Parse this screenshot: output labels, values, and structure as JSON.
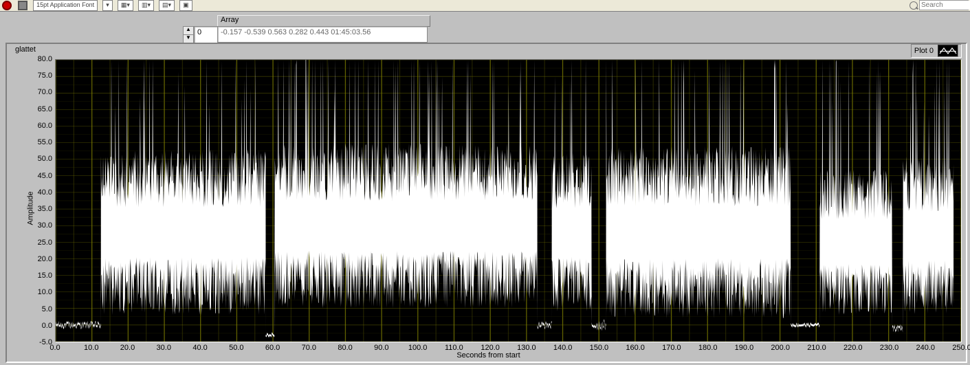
{
  "toolbar": {
    "font_selector": "15pt Application Font",
    "search_placeholder": "Search"
  },
  "array_control": {
    "label": "Array",
    "index": "0",
    "value": "-0.157 -0.539 0.563 0.282 0.443  01:45:03.56"
  },
  "graph": {
    "label": "glattet",
    "legend_label": "Plot 0"
  },
  "chart_data": {
    "type": "line",
    "title": "",
    "xlabel": "Seconds from start",
    "ylabel": "Amplitude",
    "xlim": [
      0,
      250
    ],
    "ylim": [
      -5,
      80
    ],
    "xticks": [
      0,
      10,
      20,
      30,
      40,
      50,
      60,
      70,
      80,
      90,
      100,
      110,
      120,
      130,
      140,
      150,
      160,
      170,
      180,
      190,
      200,
      210,
      220,
      230,
      240,
      250
    ],
    "yticks": [
      -5,
      0,
      5,
      10,
      15,
      20,
      25,
      30,
      35,
      40,
      45,
      50,
      55,
      60,
      65,
      70,
      75,
      80
    ],
    "series_name": "Plot 0",
    "segments": [
      {
        "x0": 0,
        "x1": 12.5,
        "base": 0,
        "jitter": 2,
        "peak": 2,
        "density": "sparse"
      },
      {
        "x0": 12.5,
        "x1": 58,
        "base": 28,
        "jitter": 25,
        "peak": 75,
        "density": "dense"
      },
      {
        "x0": 58,
        "x1": 60.5,
        "base": -3,
        "jitter": 1,
        "peak": 0,
        "density": "sparse"
      },
      {
        "x0": 60.5,
        "x1": 133,
        "base": 30,
        "jitter": 25,
        "peak": 78,
        "density": "dense"
      },
      {
        "x0": 133,
        "x1": 137,
        "base": 0,
        "jitter": 2,
        "peak": 4,
        "density": "sparse"
      },
      {
        "x0": 137,
        "x1": 148,
        "base": 28,
        "jitter": 24,
        "peak": 72,
        "density": "dense"
      },
      {
        "x0": 148,
        "x1": 152,
        "base": 0,
        "jitter": 3,
        "peak": 5,
        "density": "sparse"
      },
      {
        "x0": 152,
        "x1": 203,
        "base": 28,
        "jitter": 26,
        "peak": 76,
        "density": "dense"
      },
      {
        "x0": 203,
        "x1": 211,
        "base": 0,
        "jitter": 1,
        "peak": 1,
        "density": "sparse"
      },
      {
        "x0": 211,
        "x1": 231,
        "base": 25,
        "jitter": 22,
        "peak": 74,
        "density": "dense"
      },
      {
        "x0": 231,
        "x1": 234,
        "base": -1,
        "jitter": 2,
        "peak": 3,
        "density": "sparse"
      },
      {
        "x0": 234,
        "x1": 248,
        "base": 27,
        "jitter": 24,
        "peak": 68,
        "density": "dense"
      }
    ]
  }
}
